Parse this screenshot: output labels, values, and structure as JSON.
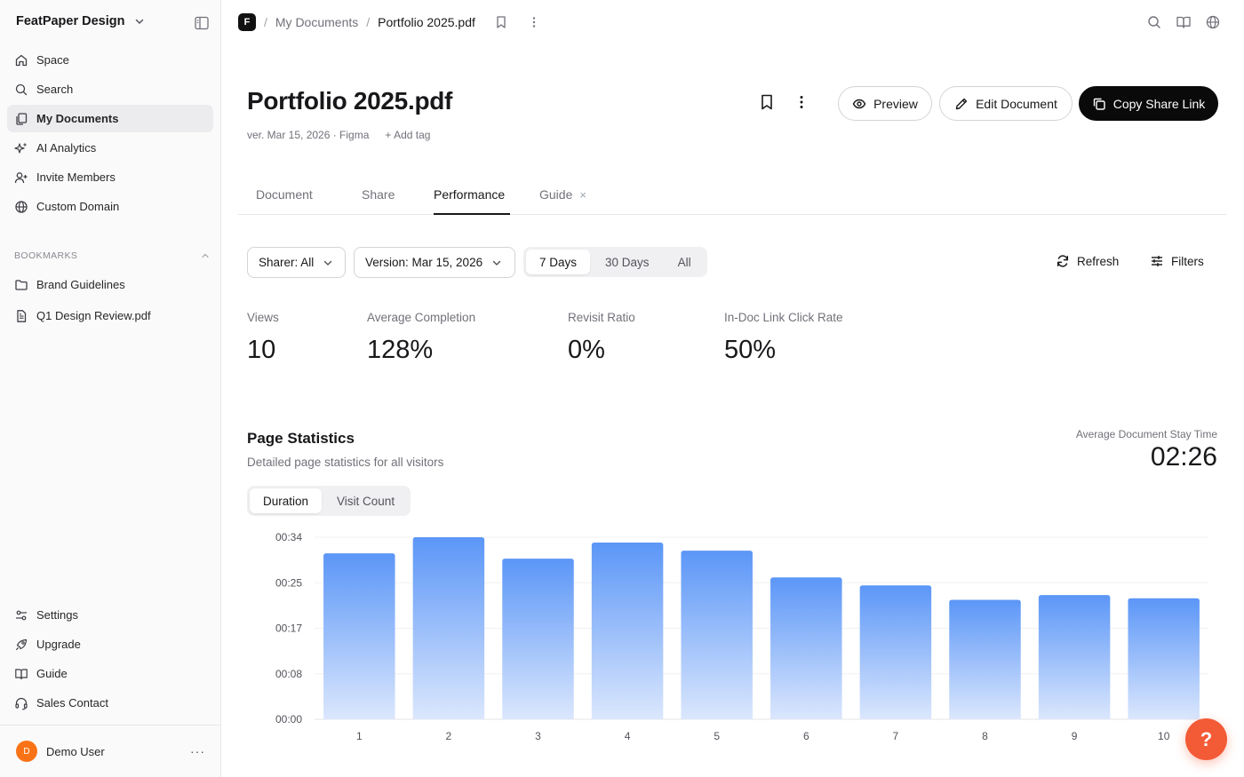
{
  "workspace": {
    "name": "FeatPaper Design"
  },
  "sidebar": {
    "nav": [
      {
        "label": "Space",
        "icon": "home-icon"
      },
      {
        "label": "Search",
        "icon": "search-icon"
      },
      {
        "label": "My Documents",
        "icon": "documents-icon",
        "active": true
      },
      {
        "label": "AI Analytics",
        "icon": "sparkles-icon"
      },
      {
        "label": "Invite Members",
        "icon": "user-plus-icon"
      },
      {
        "label": "Custom Domain",
        "icon": "globe-icon"
      }
    ],
    "bookmarks_label": "BOOKMARKS",
    "bookmarks": [
      {
        "label": "Brand Guidelines",
        "icon": "folder-icon"
      },
      {
        "label": "Q1 Design Review.pdf",
        "icon": "file-icon"
      }
    ],
    "bottom": [
      {
        "label": "Settings",
        "icon": "settings-icon"
      },
      {
        "label": "Upgrade",
        "icon": "rocket-icon"
      },
      {
        "label": "Guide",
        "icon": "book-icon"
      },
      {
        "label": "Sales Contact",
        "icon": "headset-icon"
      }
    ],
    "user": {
      "initial": "D",
      "name": "Demo User",
      "more": "···"
    }
  },
  "topbar": {
    "logo": "F",
    "breadcrumb": {
      "parent": "My Documents",
      "current": "Portfolio 2025.pdf",
      "sep": "/"
    }
  },
  "document": {
    "title": "Portfolio 2025.pdf",
    "meta": "ver. Mar 15, 2026 · Figma",
    "add_tag": "+ Add tag",
    "buttons": {
      "preview": "Preview",
      "edit": "Edit Document",
      "copy": "Copy Share Link"
    }
  },
  "tabs": {
    "document": "Document",
    "share": "Share",
    "performance": "Performance",
    "guide": "Guide",
    "close": "×"
  },
  "filters": {
    "sharer": "Sharer: All",
    "version": "Version: Mar 15, 2026",
    "ranges": [
      "7 Days",
      "30 Days",
      "All"
    ],
    "refresh": "Refresh",
    "filters": "Filters"
  },
  "stats": [
    {
      "label": "Views",
      "value": "10"
    },
    {
      "label": "Average Completion",
      "value": "128%"
    },
    {
      "label": "Revisit Ratio",
      "value": "0%"
    },
    {
      "label": "In-Doc Link Click Rate",
      "value": "50%"
    }
  ],
  "page_stats": {
    "title": "Page Statistics",
    "subtitle": "Detailed page statistics for all visitors",
    "stay_label": "Average Document Stay Time",
    "stay_value": "02:26",
    "toggle": [
      "Duration",
      "Visit Count"
    ]
  },
  "colors": {
    "bar_top": "#5b96f7",
    "bar_bottom": "#dbe7fd",
    "accent": "#0a0a0a",
    "help": "#f35a36"
  },
  "help": {
    "label": "?"
  },
  "chart_data": {
    "type": "bar",
    "categories": [
      "1",
      "2",
      "3",
      "4",
      "5",
      "6",
      "7",
      "8",
      "9",
      "10"
    ],
    "values": [
      31,
      34,
      30,
      33,
      31.5,
      26.5,
      25,
      22.3,
      23.2,
      22.6
    ],
    "ylim": [
      0,
      34
    ],
    "yticks": [
      0,
      8.5,
      17,
      25.5,
      34
    ],
    "ytick_labels": [
      "00:00",
      "00:08",
      "00:17",
      "00:25",
      "00:34"
    ],
    "xlabel": "",
    "ylabel": "",
    "grid": true
  }
}
